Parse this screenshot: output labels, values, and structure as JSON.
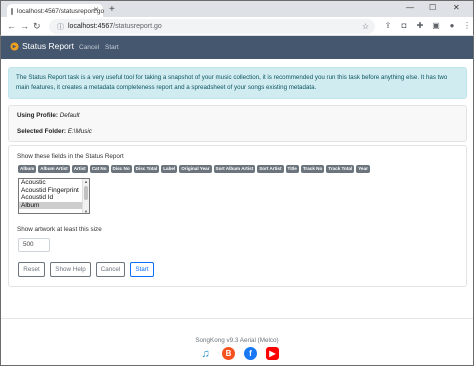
{
  "browser": {
    "tab_title": "localhost:4567/statusreport.go",
    "url_host": "localhost:4567",
    "url_path": "/statusreport.go"
  },
  "nav": {
    "brand": "Status Report",
    "links": [
      "Cancel",
      "Start"
    ]
  },
  "alert": {
    "text": "The Status Report task is a very useful tool for taking a snapshot of your music collection, it is recommended you run this task before anything else. It has two main features, it creates a metadata completeness report and a spreadsheet of your songs existing metadata."
  },
  "profile": {
    "label": "Using Profile:",
    "value": "Default",
    "folder_label": "Selected Folder:",
    "folder_value": "E:\\Music"
  },
  "fields": {
    "title": "Show these fields in the Status Report",
    "chips": [
      "Album",
      "Album Artist",
      "Artist",
      "Cat No",
      "Disc No",
      "Disc Total",
      "Label",
      "Original Year",
      "Sort Album Artist",
      "Sort Artist",
      "Title",
      "Track No",
      "Track Total",
      "Year"
    ],
    "options": [
      "Acoustic",
      "Acoustid Fingerprint",
      "Acoustid Id",
      "Album"
    ],
    "selected_option": "Album"
  },
  "artwork": {
    "label": "Show artwork at least this size",
    "value": "500"
  },
  "buttons": {
    "reset": "Reset",
    "show_help": "Show Help",
    "cancel": "Cancel",
    "start": "Start"
  },
  "footer": {
    "version": "SongKong v9.3 Aerial (Melco)"
  },
  "colors": {
    "navbar": "#45576e",
    "alert_bg": "#d1ecf1",
    "chip": "#6c757d",
    "primary": "#0d6efd"
  }
}
